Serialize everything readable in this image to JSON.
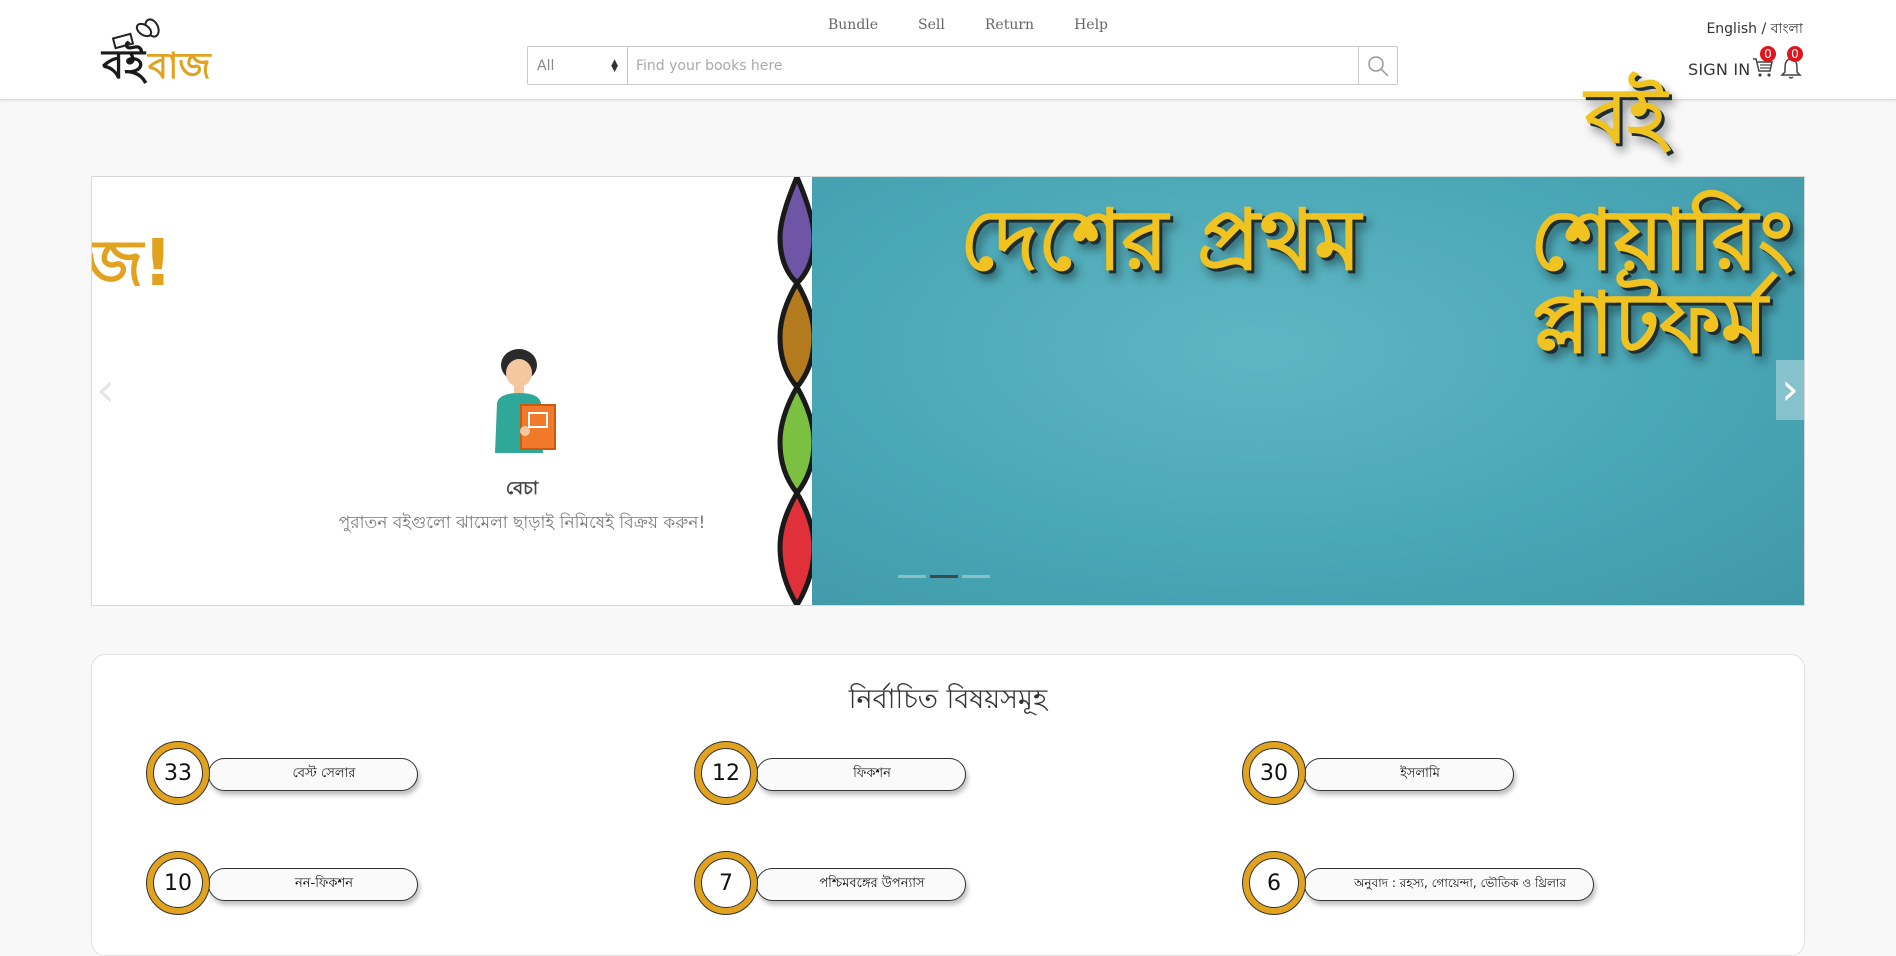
{
  "header": {
    "logo_text": "বইবাজ",
    "nav": [
      "Bundle",
      "Sell",
      "Return",
      "Help"
    ],
    "search": {
      "category": "All",
      "placeholder": "Find your books here"
    },
    "language": "English / বাংলা",
    "sign_in": "SIGN IN",
    "cart_count": "0",
    "notification_count": "0",
    "accent_color": "#e0141b"
  },
  "banner": {
    "left_partial_word": "জ!",
    "sell_title": "বেচা",
    "sell_subtitle": "পুরাতন বইগুলো ঝামেলা ছাড়াই নিমিষেই বিক্রয় করুন!",
    "headline_lines": [
      "বই",
      "দেশের প্রথম",
      "শেয়ারিং",
      "প্লাটফর্ম"
    ],
    "active_slide": 1,
    "slide_count": 3,
    "colors": {
      "brand": "#e0a21f",
      "banner_bg": "#4aa7b6",
      "headline": "#f0c320"
    }
  },
  "categories": {
    "title": "নির্বাচিত বিষয়সমূহ",
    "items": [
      {
        "count": "33",
        "label": "বেস্ট সেলার"
      },
      {
        "count": "12",
        "label": "ফিকশন"
      },
      {
        "count": "30",
        "label": "ইসলামি"
      },
      {
        "count": "10",
        "label": "নন-ফিকশন"
      },
      {
        "count": "7",
        "label": "পশ্চিমবঙ্গের উপন্যাস"
      },
      {
        "count": "6",
        "label": "অনুবাদ : রহস্য, গোয়েন্দা, ভৌতিক ও থ্রিলার"
      }
    ]
  }
}
